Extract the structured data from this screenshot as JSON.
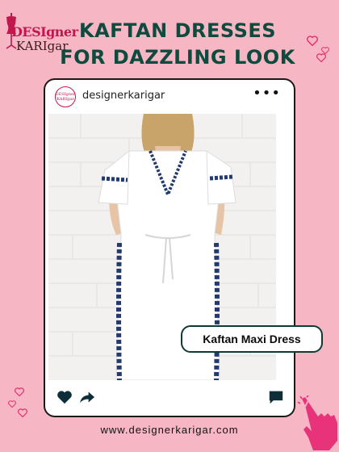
{
  "brand": {
    "logo_line1": "DESIgner",
    "logo_line2": "KARIgar"
  },
  "headline": {
    "line1": "KAFTAN DRESSES",
    "line2": "FOR DAZZLING LOOK"
  },
  "post": {
    "avatar_text": "DESIgner KARIgar",
    "username": "designerkarigar",
    "more_label": "•••",
    "product_label": "Kaftan Maxi Dress"
  },
  "footer": {
    "website": "www.designerkarigar.com"
  },
  "colors": {
    "background": "#f7b6c4",
    "headline": "#0e4a3d",
    "brand_pink": "#c0174f",
    "heart": "#e0306a",
    "icon_dark": "#0e2f3a"
  },
  "icons": [
    "dress-form-icon",
    "heart-icon",
    "share-icon",
    "comment-icon",
    "more-icon",
    "pointing-hand-icon"
  ]
}
